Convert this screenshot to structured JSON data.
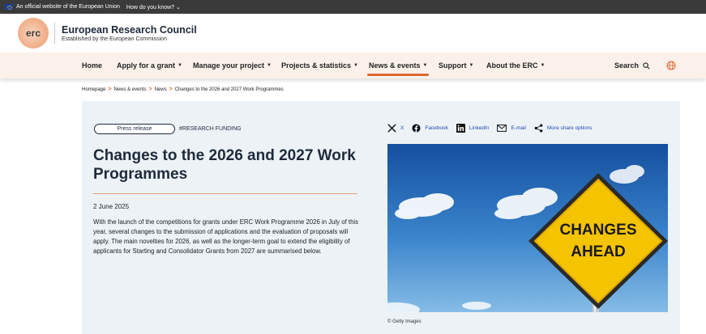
{
  "eu_bar": {
    "official_text": "An official website of the European Union",
    "how_text": "How do you know?",
    "caret": "⌄"
  },
  "header": {
    "logo_text": "erc",
    "org_name": "European Research Council",
    "org_sub": "Established by the European Commission"
  },
  "nav": {
    "items": [
      {
        "label": "Home",
        "dropdown": false
      },
      {
        "label": "Apply for a grant",
        "dropdown": true
      },
      {
        "label": "Manage your project",
        "dropdown": true
      },
      {
        "label": "Projects & statistics",
        "dropdown": true
      },
      {
        "label": "News & events",
        "dropdown": true,
        "active": true
      },
      {
        "label": "Support",
        "dropdown": true
      },
      {
        "label": "About the ERC",
        "dropdown": true
      }
    ],
    "caret": "▼",
    "search_label": "Search",
    "accent": "#e2652e"
  },
  "breadcrumb": {
    "items": [
      "Homepage",
      "News & events",
      "News",
      "Changes to the 2026 and 2027 Work Programmes"
    ],
    "separator": ">"
  },
  "article": {
    "tag": "Press release",
    "topic": "#RESEARCH FUNDING",
    "title": "Changes to the 2026 and 2027 Work Programmes",
    "date": "2 June 2025",
    "body": "With the launch of the competitions for grants under ERC Work Programme 2026 in July of this year, several changes to the submission of applications and the evaluation of proposals will apply. The main novelties for 2026, as well as the longer-term goal to extend the eligibility of applicants for Starting and Consolidator Grants from 2027 are summarised below."
  },
  "share": {
    "x_label": "X",
    "facebook_label": "Facebook",
    "linkedin_label": "LinkedIn",
    "email_label": "E-mail",
    "more_label": "More share options"
  },
  "image": {
    "sign_line1": "CHANGES",
    "sign_line2": "AHEAD",
    "caption": "© Getty Images"
  },
  "colors": {
    "nav_bg": "#fcf1ea",
    "panel_bg": "#edf2f7",
    "title": "#1e2a3b",
    "link": "#1e4ea8",
    "sign_yellow": "#f5c400"
  }
}
